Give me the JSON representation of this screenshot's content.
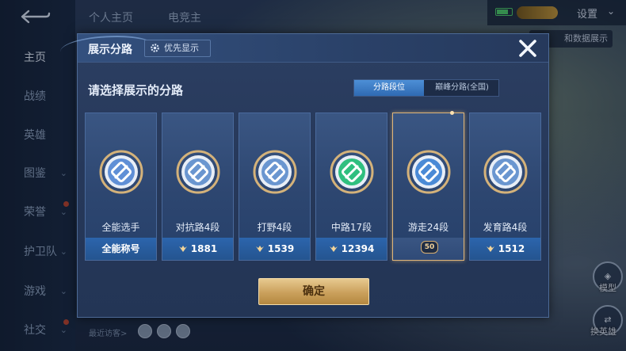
{
  "background": {
    "top_tabs": [
      "个人主页",
      "电竞主"
    ],
    "settings_label": "设置",
    "banner_text": "和数据展示",
    "nav_items": [
      {
        "label": "主页",
        "active": true,
        "chevron": false,
        "dot": false
      },
      {
        "label": "战绩",
        "active": false,
        "chevron": false,
        "dot": false
      },
      {
        "label": "英雄",
        "active": false,
        "chevron": false,
        "dot": false
      },
      {
        "label": "图鉴",
        "active": false,
        "chevron": true,
        "dot": false
      },
      {
        "label": "荣誉",
        "active": false,
        "chevron": true,
        "dot": true
      },
      {
        "label": "护卫队",
        "active": false,
        "chevron": true,
        "dot": false
      },
      {
        "label": "游戏",
        "active": false,
        "chevron": true,
        "dot": false
      },
      {
        "label": "社交",
        "active": false,
        "chevron": true,
        "dot": true
      }
    ],
    "recent_visitors_label": "最近访客>",
    "side_buttons": [
      "模型",
      "换英雄"
    ]
  },
  "modal": {
    "title": "展示分路",
    "priority_button": "优先显示",
    "section_title": "请选择展示的分路",
    "tabs": [
      {
        "label": "分路段位",
        "active": true
      },
      {
        "label": "巅峰分路(全国)",
        "active": false
      }
    ],
    "cards": [
      {
        "role": "全能选手",
        "footer": "全能称号",
        "score": null,
        "selected": false,
        "emblem_color": "#5f8fd6"
      },
      {
        "role": "对抗路4段",
        "footer": "1881",
        "score": 1881,
        "selected": false,
        "emblem_color": "#6a96d0"
      },
      {
        "role": "打野4段",
        "footer": "1539",
        "score": 1539,
        "selected": false,
        "emblem_color": "#6a96d0"
      },
      {
        "role": "中路17段",
        "footer": "12394",
        "score": 12394,
        "selected": false,
        "emblem_color": "#2fbf7f"
      },
      {
        "role": "游走24段",
        "footer": "",
        "score": null,
        "selected": true,
        "badge": "50",
        "emblem_color": "#4a8ad6"
      },
      {
        "role": "发育路4段",
        "footer": "1512",
        "score": 1512,
        "selected": false,
        "emblem_color": "#6a96d0"
      }
    ],
    "confirm_button": "确定"
  },
  "colors": {
    "accent_gold": "#caa05c",
    "selected_border": "#e0b679",
    "tab_active": "#2f6ab3"
  }
}
